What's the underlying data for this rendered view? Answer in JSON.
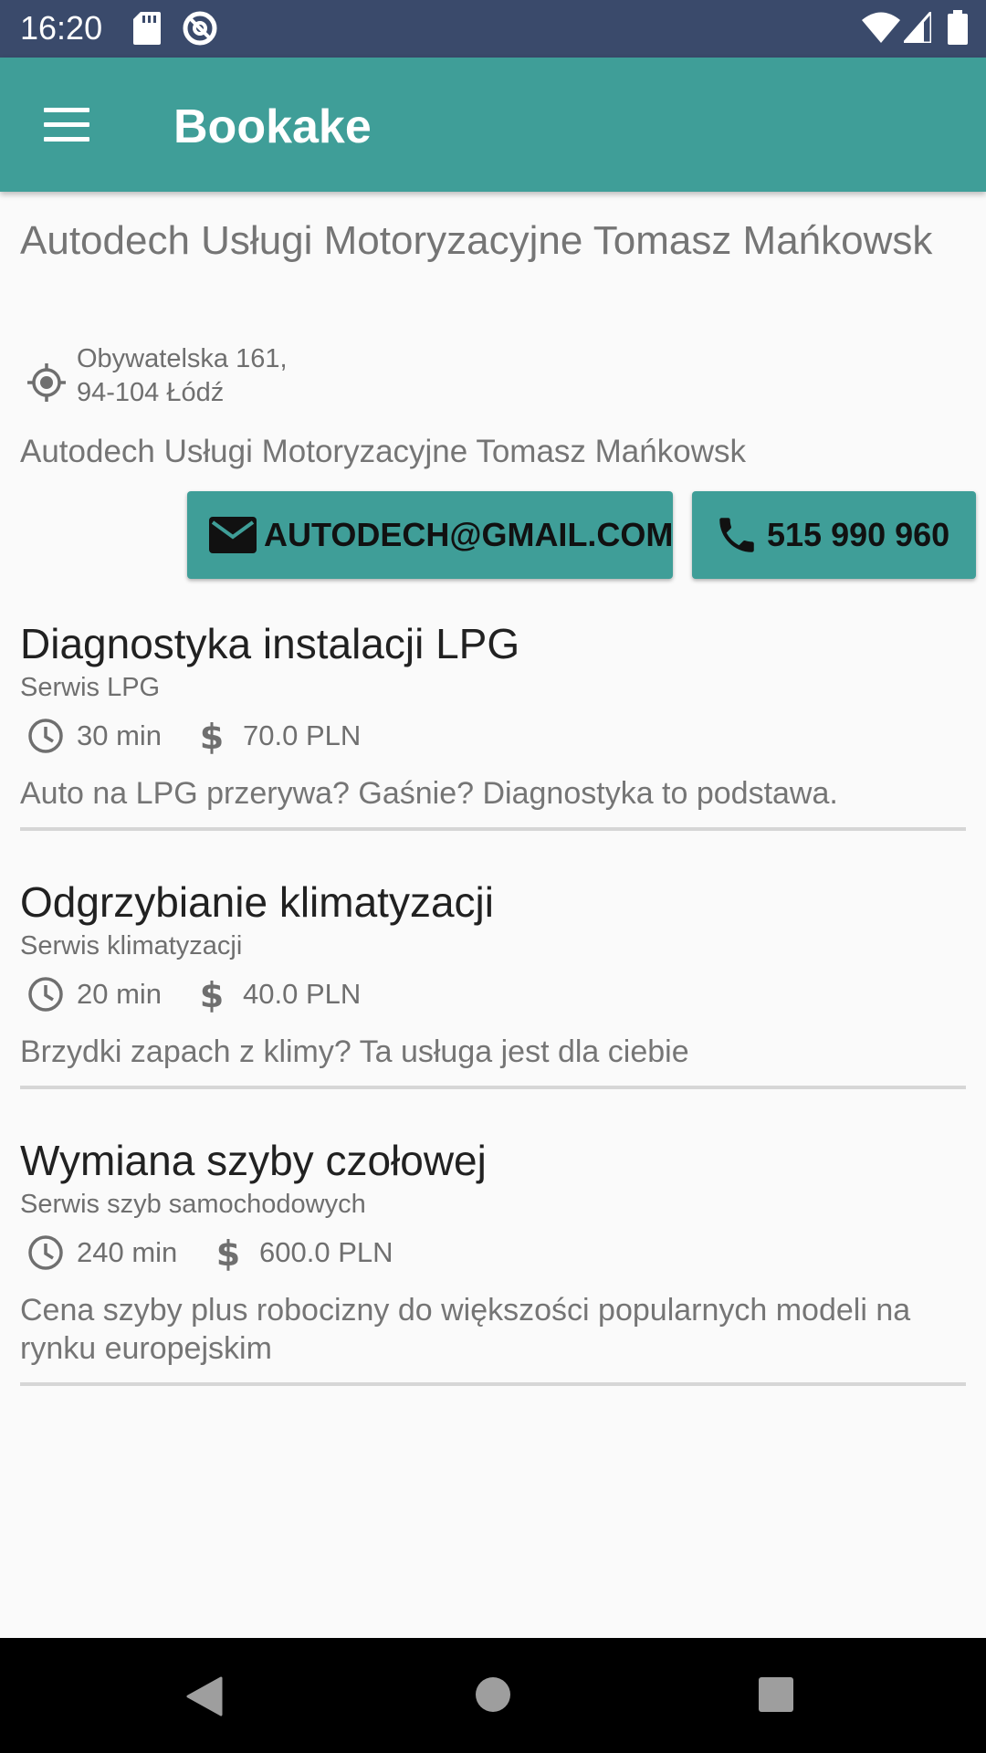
{
  "status_bar": {
    "time": "16:20",
    "left_icons": [
      "sd-card-icon",
      "at-sign-icon"
    ],
    "right_icons": [
      "wifi-icon",
      "signal-icon",
      "battery-icon"
    ],
    "background": "#3a4a6b"
  },
  "app_bar": {
    "title": "Bookake",
    "menu_icon": "menu-icon",
    "background": "#3f9e98"
  },
  "business": {
    "name": "Autodech Usługi Motoryzacyjne Tomasz Mańkowsk",
    "address_line1": "Obywatelska 161,",
    "address_line2": "94-104 Łódź",
    "description": "Autodech Usługi Motoryzacyjne Tomasz Mańkowsk",
    "email_button": "AUTODECH@GMAIL.COM",
    "phone_button": "515 990 960",
    "accent_color": "#3f9e98"
  },
  "services": [
    {
      "title": "Diagnostyka instalacji LPG",
      "category": "Serwis LPG",
      "duration": "30 min",
      "price": "70.0 PLN",
      "description": "Auto na LPG przerywa? Gaśnie? Diagnostyka to podstawa."
    },
    {
      "title": "Odgrzybianie klimatyzacji",
      "category": "Serwis klimatyzacji",
      "duration": "20 min",
      "price": "40.0 PLN",
      "description": "Brzydki zapach z klimy? Ta usługa jest dla ciebie"
    },
    {
      "title": "Wymiana szyby czołowej",
      "category": "Serwis szyb samochodowych",
      "duration": "240 min",
      "price": "600.0 PLN",
      "description": "Cena szyby plus robocizny do większości popularnych modeli na rynku europejskim"
    }
  ],
  "nav_bar": {
    "buttons": [
      "back-icon",
      "home-icon",
      "recents-icon"
    ]
  }
}
